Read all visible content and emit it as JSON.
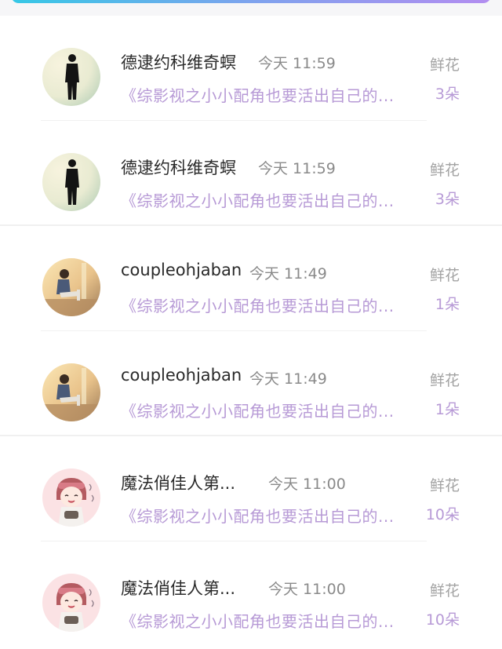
{
  "feed": {
    "items": [
      {
        "user": "德逮约科维奇螟",
        "time": "今天 11:59",
        "book": "《综影视之小小配角也要活出自己的...",
        "gift_label": "鲜花",
        "gift_count": "3朵",
        "avatar": "silhouette-avatar"
      },
      {
        "user": "德逮约科维奇螟",
        "time": "今天 11:59",
        "book": "《综影视之小小配角也要活出自己的...",
        "gift_label": "鲜花",
        "gift_count": "3朵",
        "avatar": "silhouette-avatar"
      },
      {
        "user": "coupleohjaban",
        "time": "今天 11:49",
        "book": "《综影视之小小配角也要活出自己的...",
        "gift_label": "鲜花",
        "gift_count": "1朵",
        "avatar": "sitting-person-avatar"
      },
      {
        "user": "coupleohjaban",
        "time": "今天 11:49",
        "book": "《综影视之小小配角也要活出自己的...",
        "gift_label": "鲜花",
        "gift_count": "1朵",
        "avatar": "sitting-person-avatar"
      },
      {
        "user": "魔法俏佳人第...",
        "time": "今天 11:00",
        "book": "《综影视之小小配角也要活出自己的...",
        "gift_label": "鲜花",
        "gift_count": "10朵",
        "avatar": "cartoon-girl-avatar"
      },
      {
        "user": "魔法俏佳人第...",
        "time": "今天 11:00",
        "book": "《综影视之小小配角也要活出自己的...",
        "gift_label": "鲜花",
        "gift_count": "10朵",
        "avatar": "cartoon-girl-avatar"
      }
    ]
  },
  "colors": {
    "gradient_start": "#36c8e6",
    "gradient_end": "#b38df0",
    "accent_purple": "#b79ad6",
    "name_text": "#2a2a2a",
    "time_text": "#8a8a8a"
  }
}
